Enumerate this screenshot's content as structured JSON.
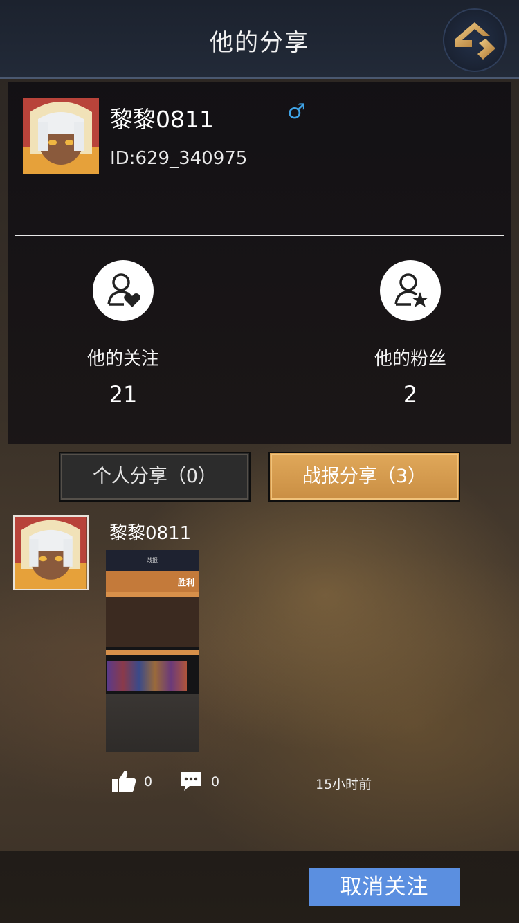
{
  "header": {
    "title": "他的分享",
    "back_icon": "back-arrow-icon"
  },
  "profile": {
    "name": "黎黎0811",
    "gender_symbol": "♂",
    "id_text": "ID:629_340975",
    "avatar_icon": "avatar-character",
    "stats": {
      "following": {
        "label": "他的关注",
        "value": "21",
        "icon": "user-heart-icon"
      },
      "fans": {
        "label": "他的粉丝",
        "value": "2",
        "icon": "user-star-icon"
      }
    }
  },
  "tabs": {
    "personal": "个人分享（0）",
    "battle": "战报分享（3）",
    "active": "battle"
  },
  "post": {
    "author": "黎黎0811",
    "thumbnail": {
      "header": "战报",
      "result": "胜利"
    },
    "likes": "0",
    "comments": "0",
    "time": "15小时前"
  },
  "footer": {
    "unfollow_label": "取消关注"
  },
  "colors": {
    "accent_gold": "#d49a50",
    "unfollow_blue": "#5b8fe0",
    "gender_blue": "#3fa3e6"
  }
}
